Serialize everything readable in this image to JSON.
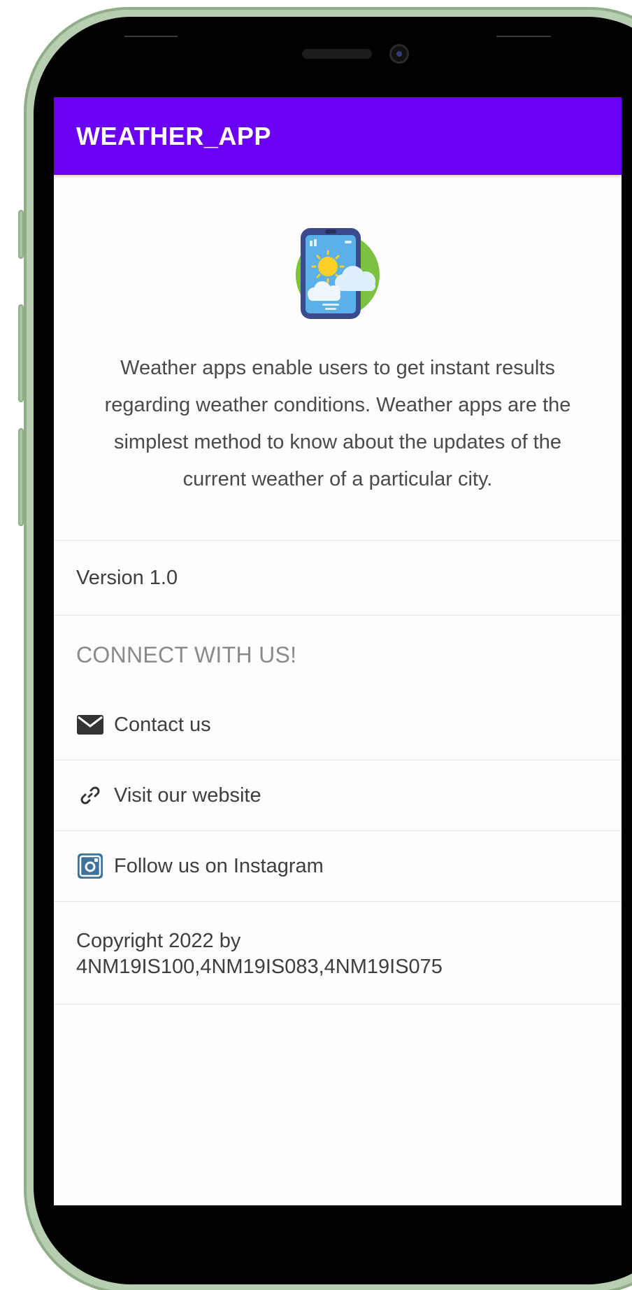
{
  "app": {
    "title": "WEATHER_APP"
  },
  "about": {
    "logo_icon": "weather-phone-icon",
    "description": "Weather apps enable users to get instant results regarding weather conditions. Weather apps are the simplest method to know about the updates of the current weather of a particular city.",
    "version": "Version 1.0"
  },
  "connect": {
    "title": "CONNECT WITH US!",
    "items": [
      {
        "label": "Contact us",
        "icon": "envelope-icon"
      },
      {
        "label": "Visit our website",
        "icon": "link-icon"
      },
      {
        "label": "Follow us on Instagram",
        "icon": "instagram-icon"
      }
    ]
  },
  "footer": {
    "copyright_line1": "Copyright 2022 by",
    "copyright_line2": "4NM19IS100,4NM19IS083,4NM19IS075"
  },
  "colors": {
    "appbar": "#6a00f4",
    "frame": "#b7cfb0",
    "text": "#3e3e3e",
    "muted": "#8a8a8a"
  }
}
